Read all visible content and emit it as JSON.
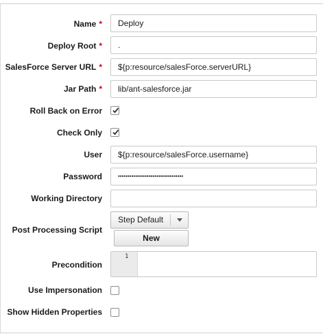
{
  "form": {
    "required_marker": "*",
    "fields": {
      "name": {
        "label": "Name",
        "value": "Deploy"
      },
      "deploy_root": {
        "label": "Deploy Root",
        "value": "."
      },
      "server_url": {
        "label": "SalesForce Server URL",
        "value": "${p:resource/salesForce.serverURL}"
      },
      "jar_path": {
        "label": "Jar Path",
        "value": "lib/ant-salesforce.jar"
      },
      "roll_back": {
        "label": "Roll Back on Error",
        "checked": true
      },
      "check_only": {
        "label": "Check Only",
        "checked": true
      },
      "user": {
        "label": "User",
        "value": "${p:resource/salesForce.username}"
      },
      "password": {
        "label": "Password",
        "value": "••••••••••••••••••••••••••••••••••"
      },
      "working_dir": {
        "label": "Working Directory",
        "value": ""
      },
      "post_processing": {
        "label": "Post Processing Script",
        "selected": "Step Default",
        "new_button": "New"
      },
      "precondition": {
        "label": "Precondition",
        "line_number": "1"
      },
      "impersonation": {
        "label": "Use Impersonation",
        "checked": false
      },
      "hidden_props": {
        "label": "Show Hidden Properties",
        "checked": false
      }
    }
  }
}
